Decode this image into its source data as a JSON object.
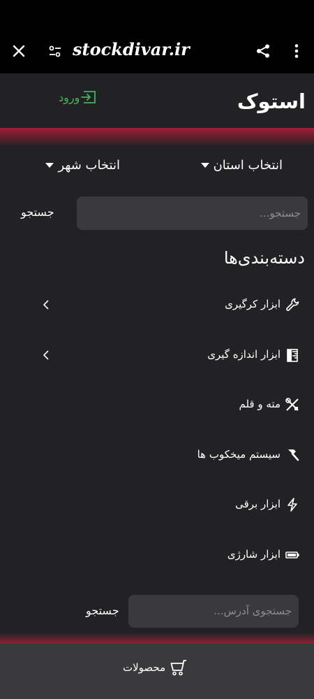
{
  "browser": {
    "url": "stockdivar.ir"
  },
  "header": {
    "brand": "استوک",
    "login": "ورود"
  },
  "filters": {
    "province": "انتخاب استان",
    "city": "انتخاب شهر"
  },
  "search": {
    "placeholder": "جستجو...",
    "button": "جستجو"
  },
  "categories": {
    "title": "دسته‌بندی‌ها",
    "items": [
      {
        "label": "ابزار کرگیری",
        "icon": "wrench-icon",
        "has_children": true
      },
      {
        "label": "ابزار اندازه گیری",
        "icon": "ruler-icon",
        "has_children": true
      },
      {
        "label": "مته و قلم",
        "icon": "tools-icon",
        "has_children": false
      },
      {
        "label": "سیستم میخکوب ها",
        "icon": "hammer-icon",
        "has_children": false
      },
      {
        "label": "ابزار برقی",
        "icon": "lightning-icon",
        "has_children": false
      },
      {
        "label": "ابزار شارژی",
        "icon": "battery-icon",
        "has_children": false
      }
    ]
  },
  "address_search": {
    "placeholder": "جستجوی آدرس...",
    "button": "جستجو"
  },
  "bottom_nav": {
    "products": "محصولات"
  },
  "colors": {
    "background": "#222224",
    "browser_bar": "#000000",
    "accent_green": "#3fb560",
    "glow_red": "#cd1e3e",
    "input_bg": "#3a3a3c",
    "bottom_nav": "#3a3a3d"
  }
}
